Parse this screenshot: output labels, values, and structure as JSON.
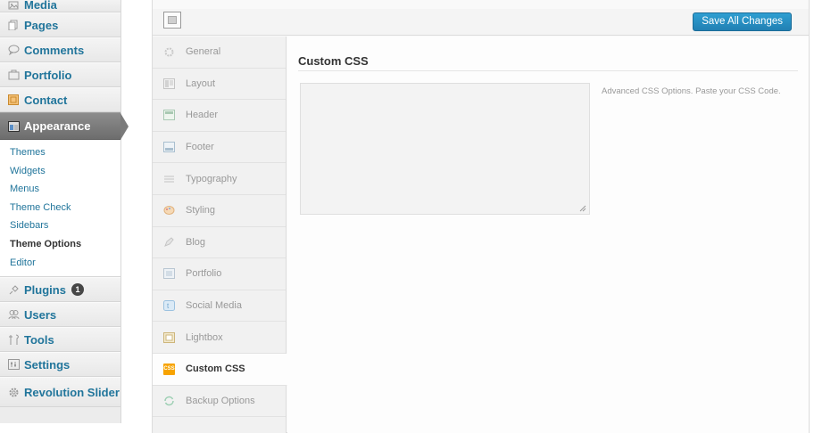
{
  "sidebar": {
    "top_items": [
      {
        "label": "Media",
        "icon": "media-icon"
      },
      {
        "label": "Pages",
        "icon": "pages-icon"
      },
      {
        "label": "Comments",
        "icon": "comments-icon"
      },
      {
        "label": "Portfolio",
        "icon": "portfolio-icon"
      },
      {
        "label": "Contact",
        "icon": "contact-icon"
      }
    ],
    "appearance": {
      "label": "Appearance",
      "submenu": [
        "Themes",
        "Widgets",
        "Menus",
        "Theme Check",
        "Sidebars",
        "Theme Options",
        "Editor"
      ],
      "current_sub": "Theme Options"
    },
    "bottom_items": [
      {
        "label": "Plugins",
        "icon": "plugins-icon",
        "badge": "1"
      },
      {
        "label": "Users",
        "icon": "users-icon"
      },
      {
        "label": "Tools",
        "icon": "tools-icon"
      },
      {
        "label": "Settings",
        "icon": "settings-icon"
      },
      {
        "label": "Revolution Slider",
        "icon": "gear-icon"
      }
    ],
    "colors": {
      "link": "#21759b",
      "current_bg": "#7b7b7b"
    }
  },
  "toolbar": {
    "save_label": "Save All Changes",
    "save_color": "#2180b3"
  },
  "tabs": [
    {
      "label": "General",
      "icon": "gear-icon"
    },
    {
      "label": "Layout",
      "icon": "layout-icon"
    },
    {
      "label": "Header",
      "icon": "header-icon"
    },
    {
      "label": "Footer",
      "icon": "footer-icon"
    },
    {
      "label": "Typography",
      "icon": "typography-icon"
    },
    {
      "label": "Styling",
      "icon": "styling-icon"
    },
    {
      "label": "Blog",
      "icon": "blog-icon"
    },
    {
      "label": "Portfolio",
      "icon": "portfolio-icon"
    },
    {
      "label": "Social Media",
      "icon": "social-media-icon"
    },
    {
      "label": "Lightbox",
      "icon": "lightbox-icon"
    },
    {
      "label": "Custom CSS",
      "icon": "css-icon",
      "icon_text": "CSS"
    },
    {
      "label": "Backup Options",
      "icon": "backup-icon"
    }
  ],
  "active_tab": "Custom CSS",
  "content": {
    "title": "Custom CSS",
    "textarea_value": "",
    "description": "Advanced CSS Options. Paste your CSS Code."
  }
}
